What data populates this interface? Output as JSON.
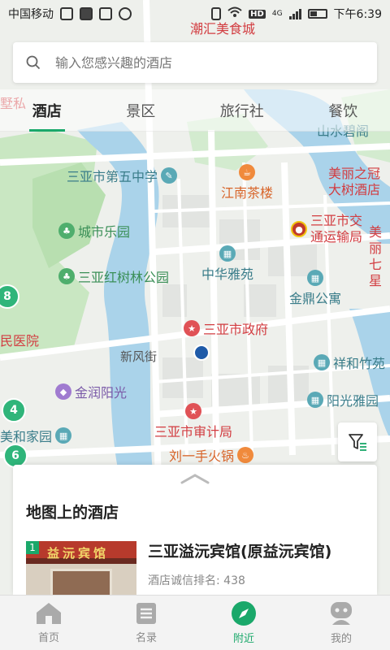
{
  "status_bar": {
    "carrier": "中国移动",
    "network_badge": "HD",
    "network_type": "4G",
    "time": "下午6:39"
  },
  "search": {
    "placeholder": "输入您感兴趣的酒店"
  },
  "tabs": [
    {
      "label": "酒店",
      "active": true
    },
    {
      "label": "景区",
      "active": false
    },
    {
      "label": "旅行社",
      "active": false
    },
    {
      "label": "餐饮",
      "active": false
    }
  ],
  "map": {
    "pois": [
      {
        "label": "潮汇美食城",
        "kind": "red"
      },
      {
        "label": "山水碧阁",
        "kind": "teal"
      },
      {
        "label": "三亚市第五中学",
        "kind": "teal"
      },
      {
        "label": "江南茶楼",
        "kind": "orange"
      },
      {
        "label": "美丽之冠大树酒店",
        "kind": "red"
      },
      {
        "label": "三亚市交通运输局",
        "kind": "red"
      },
      {
        "label": "城市乐园",
        "kind": "green"
      },
      {
        "label": "中华雅苑",
        "kind": "teal"
      },
      {
        "label": "三亚红树林公园",
        "kind": "green"
      },
      {
        "label": "金鼎公寓",
        "kind": "teal"
      },
      {
        "label": "三亚市政府",
        "kind": "red"
      },
      {
        "label": "民医院",
        "kind": "red"
      },
      {
        "label": "祥和竹苑",
        "kind": "teal"
      },
      {
        "label": "金润阳光",
        "kind": "purple"
      },
      {
        "label": "阳光雅园",
        "kind": "teal"
      },
      {
        "label": "美和家园",
        "kind": "teal"
      },
      {
        "label": "三亚市审计局",
        "kind": "red"
      },
      {
        "label": "刘一手火锅",
        "kind": "orange"
      },
      {
        "label": "墅私",
        "kind": "red"
      },
      {
        "label": "美丽七星",
        "kind": "red"
      }
    ],
    "road_labels": [
      "新风街"
    ],
    "clusters": [
      "8",
      "4",
      "6"
    ]
  },
  "sheet": {
    "title": "地图上的酒店",
    "hotels": [
      {
        "rank": "1",
        "name": "三亚溢沅宾馆(原益沅宾馆)",
        "meta": "酒店诚信排名: 438",
        "sign": "益沅宾馆"
      }
    ]
  },
  "bottom_nav": [
    {
      "label": "首页",
      "icon": "home-icon",
      "active": false
    },
    {
      "label": "名录",
      "icon": "directory-icon",
      "active": false
    },
    {
      "label": "附近",
      "icon": "compass-icon",
      "active": true
    },
    {
      "label": "我的",
      "icon": "profile-icon",
      "active": false
    }
  ],
  "colors": {
    "accent": "#1aa86a",
    "water": "#aad3ea",
    "park": "#c9e7c2"
  }
}
